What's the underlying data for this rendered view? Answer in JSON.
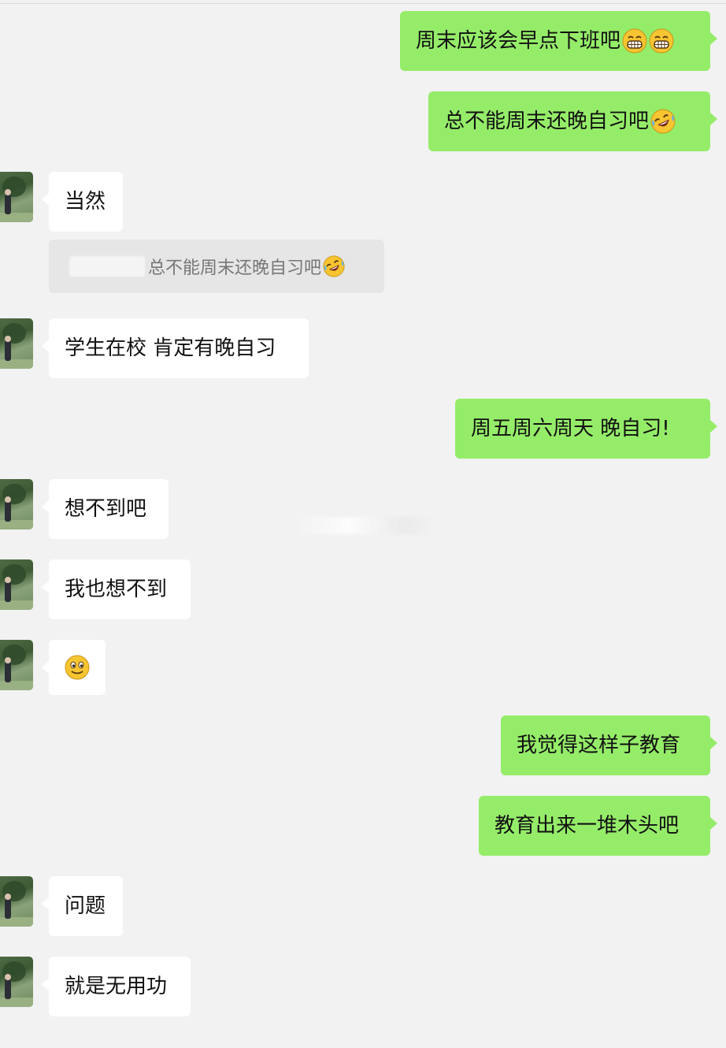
{
  "chat": {
    "messages": [
      {
        "id": "m1",
        "side": "sent",
        "text": "周末应该会早点下班吧",
        "emojis": [
          "grin-icon",
          "grin-icon"
        ]
      },
      {
        "id": "m2",
        "side": "sent",
        "text": "总不能周末还晚自习吧",
        "emojis": [
          "rofl-icon"
        ]
      },
      {
        "id": "m3",
        "side": "received",
        "text": "当然",
        "quote": {
          "author_redacted": true,
          "text": "总不能周末还晚自习吧",
          "emoji": "rofl-icon"
        }
      },
      {
        "id": "m4",
        "side": "received",
        "text": "学生在校 肯定有晚自习"
      },
      {
        "id": "m5",
        "side": "sent",
        "text": "周五周六周天 晚自习!"
      },
      {
        "id": "m6",
        "side": "received",
        "text": "想不到吧"
      },
      {
        "id": "m7",
        "side": "received",
        "text": "我也想不到"
      },
      {
        "id": "m8",
        "side": "received",
        "text": "",
        "emojis": [
          "smile-icon"
        ]
      },
      {
        "id": "m9",
        "side": "sent",
        "text": "我觉得这样子教育"
      },
      {
        "id": "m10",
        "side": "sent",
        "text": "教育出来一堆木头吧"
      },
      {
        "id": "m11",
        "side": "received",
        "text": "问题"
      },
      {
        "id": "m12",
        "side": "received",
        "text": "就是无用功"
      }
    ]
  },
  "colors": {
    "background": "#f2f2f2",
    "sent_bubble": "#95ec69",
    "received_bubble": "#ffffff",
    "quote_bg": "#e6e6e6",
    "quote_text": "#767676"
  }
}
